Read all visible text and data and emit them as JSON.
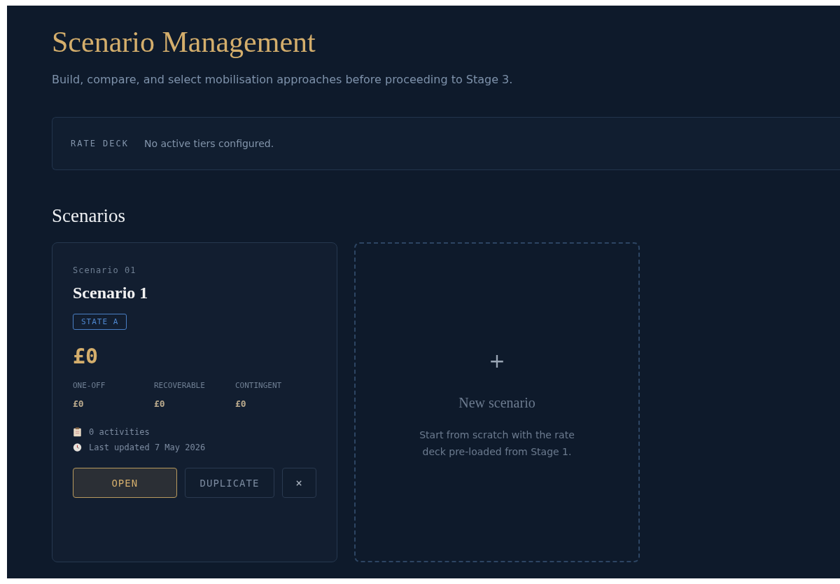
{
  "header": {
    "title": "Scenario Management",
    "subtitle": "Build, compare, and select mobilisation approaches before proceeding to Stage 3."
  },
  "rate_deck": {
    "label": "RATE DECK",
    "message": "No active tiers configured."
  },
  "scenarios_heading": "Scenarios",
  "scenarios": [
    {
      "code": "Scenario 01",
      "name": "Scenario 1",
      "state": "STATE A",
      "total": "£0",
      "breakdown": [
        {
          "label": "ONE-OFF",
          "value": "£0"
        },
        {
          "label": "RECOVERABLE",
          "value": "£0"
        },
        {
          "label": "CONTINGENT",
          "value": "£0"
        }
      ],
      "activities": "0 activities",
      "updated": "Last updated 7 May 2026",
      "actions": {
        "open": "OPEN",
        "duplicate": "DUPLICATE",
        "delete": "×"
      }
    }
  ],
  "new_card": {
    "plus": "+",
    "title": "New scenario",
    "description": "Start from scratch with the rate deck pre-loaded from Stage 1."
  }
}
